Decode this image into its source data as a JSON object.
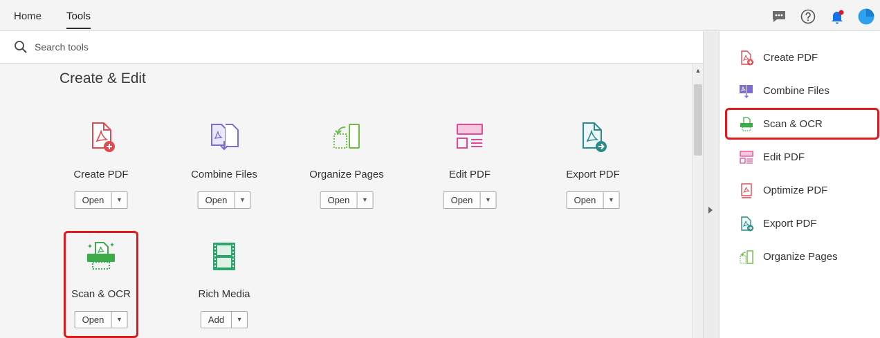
{
  "nav": {
    "home": "Home",
    "tools": "Tools"
  },
  "topbar_icons": [
    "comment-icon",
    "help-icon",
    "notification-bell-icon",
    "user-avatar"
  ],
  "search": {
    "placeholder": "Search tools"
  },
  "section": {
    "title": "Create & Edit"
  },
  "tools": [
    {
      "label": "Create PDF",
      "button": "Open",
      "icon": "create-pdf-icon",
      "color": "#e34850"
    },
    {
      "label": "Combine Files",
      "button": "Open",
      "icon": "combine-files-icon",
      "color": "#7d6bd6"
    },
    {
      "label": "Organize Pages",
      "button": "Open",
      "icon": "organize-pages-icon",
      "color": "#6dbd45"
    },
    {
      "label": "Edit PDF",
      "button": "Open",
      "icon": "edit-pdf-icon",
      "color": "#e34896"
    },
    {
      "label": "Export PDF",
      "button": "Open",
      "icon": "export-pdf-icon",
      "color": "#2b8a8a"
    },
    {
      "label": "Scan & OCR",
      "button": "Open",
      "icon": "scan-ocr-icon",
      "color": "#3dab4a"
    },
    {
      "label": "Rich Media",
      "button": "Add",
      "icon": "rich-media-icon",
      "color": "#2ea56b"
    }
  ],
  "right_panel": {
    "items": [
      {
        "label": "Create PDF",
        "icon": "create-pdf-icon"
      },
      {
        "label": "Combine Files",
        "icon": "combine-files-icon"
      },
      {
        "label": "Scan & OCR",
        "icon": "scan-ocr-icon"
      },
      {
        "label": "Edit PDF",
        "icon": "edit-pdf-icon"
      },
      {
        "label": "Optimize PDF",
        "icon": "optimize-pdf-icon"
      },
      {
        "label": "Export PDF",
        "icon": "export-pdf-icon"
      },
      {
        "label": "Organize Pages",
        "icon": "organize-pages-icon"
      }
    ]
  },
  "colors": {
    "highlight": "#e0191e",
    "accent_blue": "#1473e6"
  }
}
